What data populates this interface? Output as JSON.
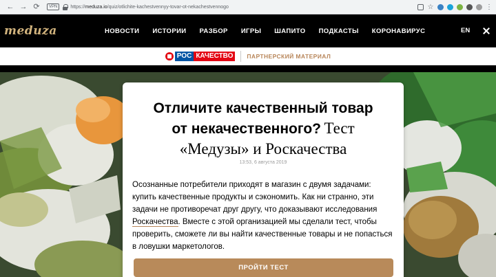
{
  "browser": {
    "url_prefix": "https://",
    "url_host": "meduza.io",
    "url_path": "/quiz/otlichite-kachestvennyy-tovar-ot-nekachestvennogo",
    "vpn_label": "VPN"
  },
  "site": {
    "logo": "meduza",
    "nav": [
      "НОВОСТИ",
      "ИСТОРИИ",
      "РАЗБОР",
      "ИГРЫ",
      "ШАПИТО",
      "ПОДКАСТЫ",
      "КОРОНАВИРУС"
    ],
    "lang": "EN"
  },
  "partner": {
    "logo_ros": "РОС",
    "logo_kach": "КАЧЕСТВО",
    "label": "ПАРТНЕРСКИЙ МАТЕРИАЛ"
  },
  "article": {
    "title_bold_1": "Отличите качественный товар",
    "title_bold_2": "от некачественного?",
    "title_serif_1": "Тест",
    "title_serif_2": "«Медузы» и Роскачества",
    "date": "13:53, 6 августа 2019",
    "lead_1": "Осознанные потребители приходят в магазин с двумя задачами: купить качественные продукты и сэкономить. Как ни странно, эти задачи не противоречат друг другу, что доказывают исследования ",
    "lead_link": "Роскачества",
    "lead_2": ". Вместе с этой организацией мы сделали тест, чтобы проверить, сможете ли вы найти качественные товары и не попасться в ловушки маркетологов.",
    "button": "ПРОЙТИ ТЕСТ"
  },
  "colors": {
    "header_bg": "#000000",
    "logo": "#d1b37d",
    "accent": "#b88a5a",
    "ros_blue": "#0055a4",
    "kach_red": "#e30613"
  }
}
